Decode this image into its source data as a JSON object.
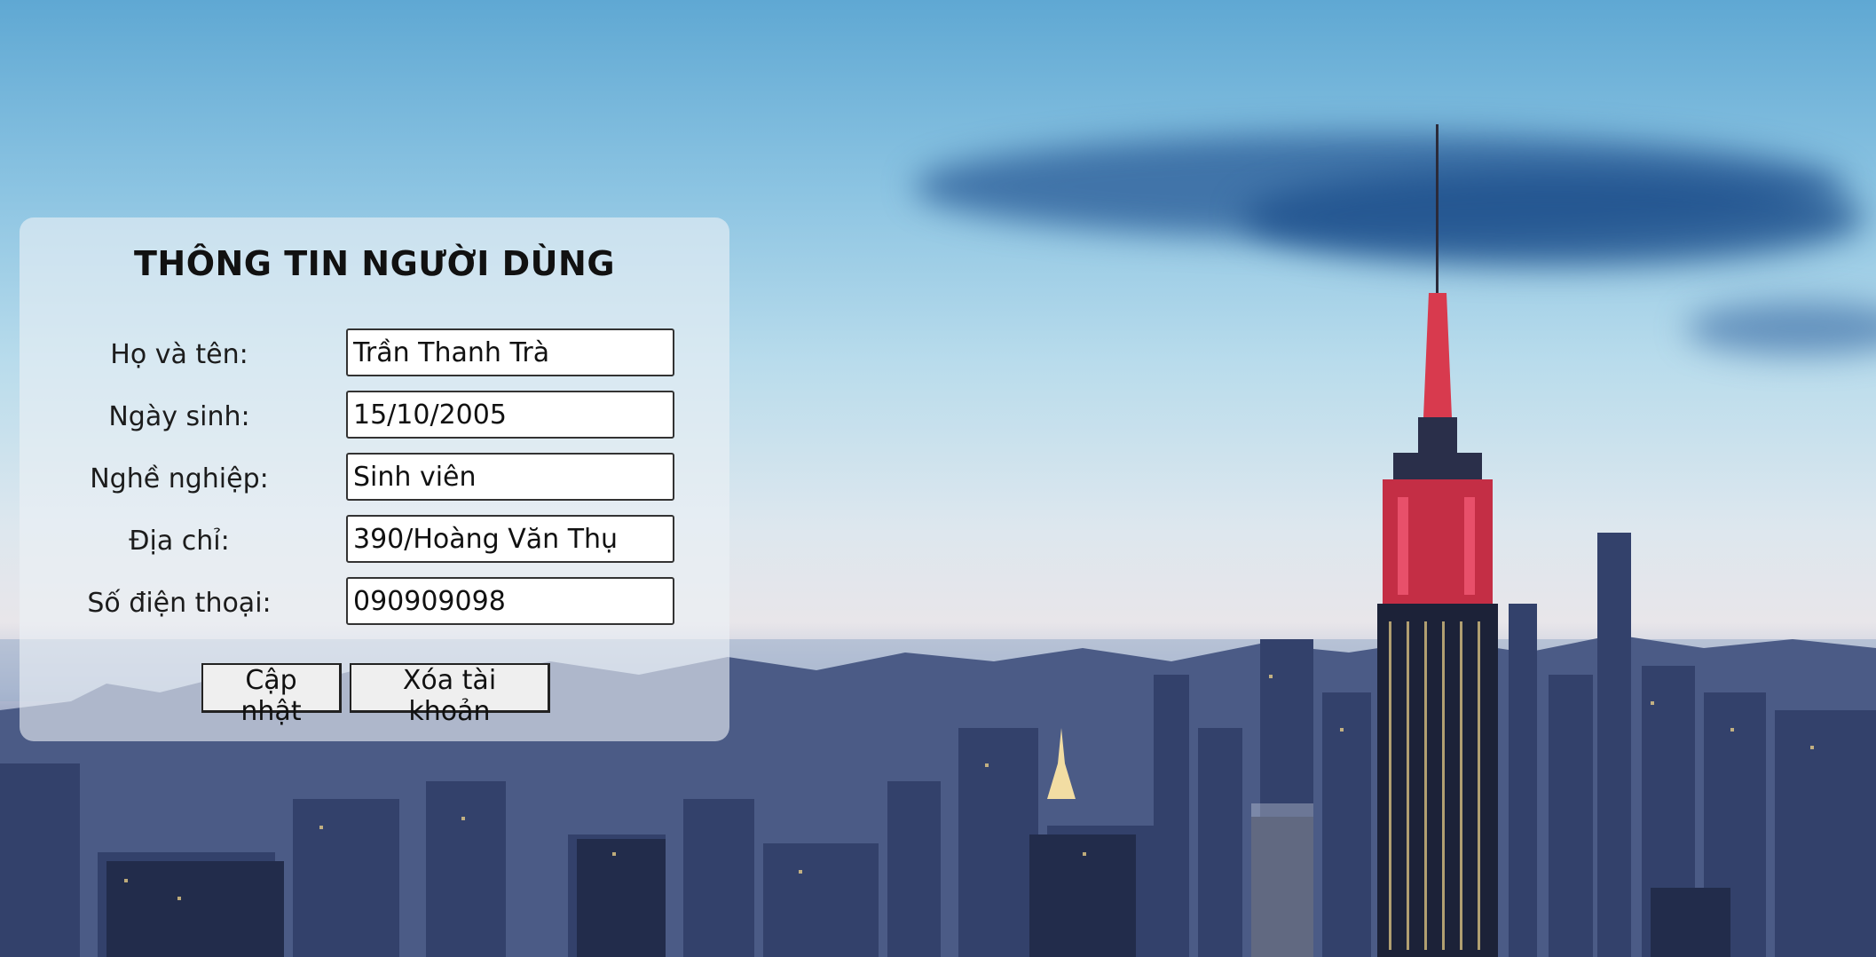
{
  "form": {
    "title": "THÔNG TIN NGƯỜI DÙNG",
    "fields": [
      {
        "label": "Họ và tên:",
        "value": "Trần Thanh Trà"
      },
      {
        "label": "Ngày sinh:",
        "value": "15/10/2005"
      },
      {
        "label": "Nghề nghiệp:",
        "value": "Sinh viên"
      },
      {
        "label": "Địa chỉ:",
        "value": "390/Hoàng Văn Thụ"
      },
      {
        "label": "Số điện thoại:",
        "value": "090909098"
      }
    ],
    "buttons": {
      "update_label": "Cập nhật",
      "delete_label": "Xóa tài khoản"
    }
  },
  "colors": {
    "panel_bg": "#ebf0f6",
    "sky_top": "#5fa8d3",
    "city_dark": "#27345a",
    "spire_red": "#e0304a"
  }
}
